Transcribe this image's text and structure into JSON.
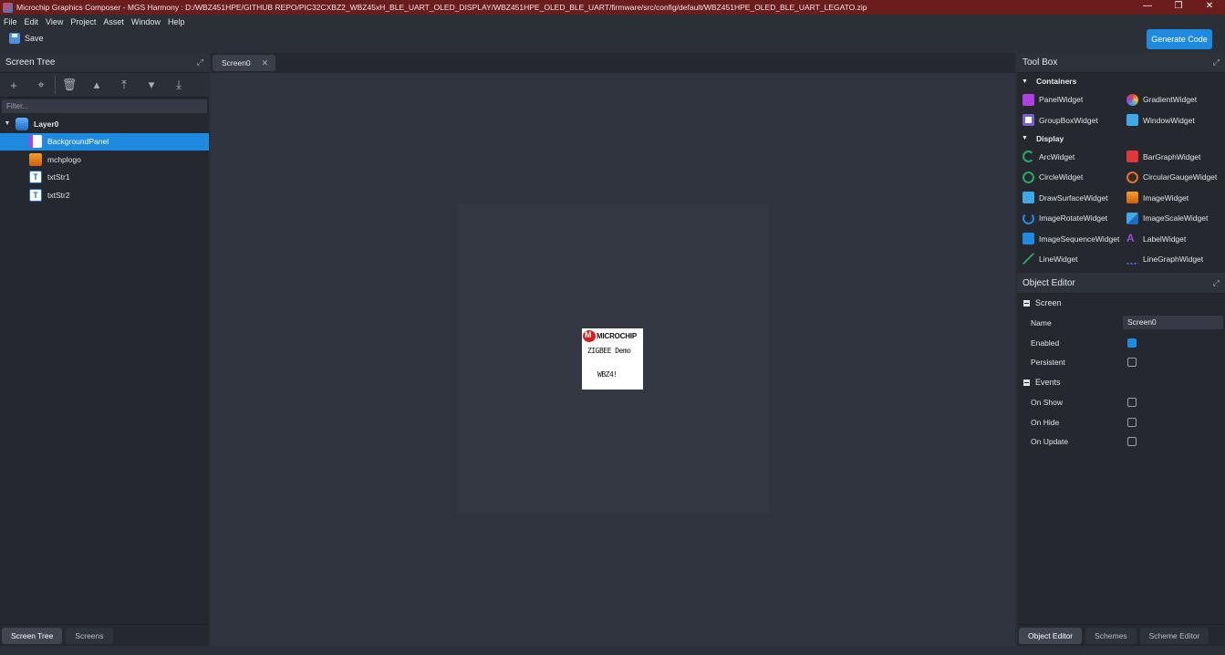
{
  "window": {
    "title": "Microchip Graphics Composer - MGS Harmony : D:/WBZ451HPE/GITHUB REPO/PIC32CXBZ2_WBZ45xH_BLE_UART_OLED_DISPLAY/WBZ451HPE_OLED_BLE_UART/firmware/src/config/default/WBZ451HPE_OLED_BLE_UART_LEGATO.zip",
    "minimize": "—",
    "restore": "❐",
    "close": "✕"
  },
  "menu": [
    "File",
    "Edit",
    "View",
    "Project",
    "Asset",
    "Window",
    "Help"
  ],
  "toolbar": {
    "save_label": "Save",
    "generate_label": "Generate Code"
  },
  "screen_tree": {
    "title": "Screen Tree",
    "filter_placeholder": "Filter...",
    "items": [
      {
        "label": "Layer0",
        "icon": "layer-icon",
        "level": 0
      },
      {
        "label": "BackgroundPanel",
        "icon": "panel-icon",
        "level": 1,
        "selected": true
      },
      {
        "label": "mchplogo",
        "icon": "image-icon",
        "level": 1
      },
      {
        "label": "txtStr1",
        "icon": "text-icon",
        "level": 1
      },
      {
        "label": "txtStr2",
        "icon": "text-icon",
        "level": 1
      }
    ],
    "footer_tabs": [
      "Screen Tree",
      "Screens"
    ]
  },
  "editor": {
    "tab_label": "Screen0",
    "preview": {
      "brand": "MICROCHIP",
      "line2": "ZIGBEE Demo",
      "line3": "WBZ4!"
    }
  },
  "tool_box": {
    "title": "Tool Box",
    "sections": [
      {
        "label": "Containers",
        "tools": [
          {
            "label": "PanelWidget",
            "color": "#b040e0"
          },
          {
            "label": "GradientWidget",
            "color": "#e04080"
          },
          {
            "label": "GroupBoxWidget",
            "color": "#7a5cd6"
          },
          {
            "label": "WindowWidget",
            "color": "#3fa8e8"
          }
        ]
      },
      {
        "label": "Display",
        "tools": [
          {
            "label": "ArcWidget",
            "color": "#2aa860"
          },
          {
            "label": "BarGraphWidget",
            "color": "#e03838"
          },
          {
            "label": "CircleWidget",
            "color": "#2aa860"
          },
          {
            "label": "CircularGaugeWidget",
            "color": "#e07030"
          },
          {
            "label": "DrawSurfaceWidget",
            "color": "#3fa8e8"
          },
          {
            "label": "ImageWidget",
            "color": "#f0a030"
          },
          {
            "label": "ImageRotateWidget",
            "color": "#1e8ae0"
          },
          {
            "label": "ImageScaleWidget",
            "color": "#3fa8e8"
          },
          {
            "label": "ImageSequenceWidget",
            "color": "#1e8ae0"
          },
          {
            "label": "LabelWidget",
            "color": "#9a4ce0"
          },
          {
            "label": "LineWidget",
            "color": "#2aa860"
          },
          {
            "label": "LineGraphWidget",
            "color": "#4a6ce0"
          }
        ]
      }
    ]
  },
  "object_editor": {
    "title": "Object Editor",
    "groups": [
      {
        "label": "Screen",
        "props": [
          {
            "label": "Name",
            "type": "text",
            "value": "Screen0"
          },
          {
            "label": "Enabled",
            "type": "checkbox",
            "checked": true
          },
          {
            "label": "Persistent",
            "type": "checkbox",
            "checked": false
          }
        ]
      },
      {
        "label": "Events",
        "props": [
          {
            "label": "On Show",
            "type": "checkbox",
            "checked": false
          },
          {
            "label": "On Hide",
            "type": "checkbox",
            "checked": false
          },
          {
            "label": "On Update",
            "type": "checkbox",
            "checked": false
          }
        ]
      }
    ],
    "footer_tabs": [
      "Object Editor",
      "Schemes",
      "Scheme Editor"
    ]
  }
}
